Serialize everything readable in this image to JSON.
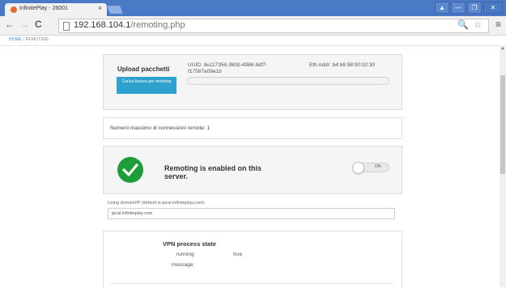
{
  "browser": {
    "tab_title": "InfinitePlay - 26001",
    "tab_close": "×",
    "url_host": "192.168.104.1",
    "url_path": "/remoting.php",
    "window_buttons": [
      "▲",
      "—",
      "❐",
      "✕"
    ]
  },
  "breadcrumb": {
    "home": "HOME",
    "separator": "/",
    "current": "REMOTING"
  },
  "upload": {
    "title": "Upload pacchetti",
    "button_label": "Carica licenza per remoting",
    "uuid_label": "UUID:",
    "uuid_value_line1": "9e117356-360b-4986-9df7-",
    "uuid_value_line2": "f17567a09e1b",
    "eth_label": "Eth Addr:",
    "eth_value": "b4:66:98:00:02:30",
    "progress_fraction": 0
  },
  "max_connections": {
    "text": "Numero massimo di connessioni remote: 1"
  },
  "remoting": {
    "status_text": "Remoting is enabled on this server.",
    "toggle_label": "ON",
    "toggle_on": true
  },
  "domain": {
    "label_prefix": "Using domain/IP (default is ",
    "label_default": "ipcal.infiniteplay.com",
    "label_suffix": ")",
    "value": "ipcal.infiniteplay.com"
  },
  "vpn": {
    "title": "VPN process state",
    "running_label": "running",
    "running_value": "true",
    "message_label": "message:"
  },
  "colors": {
    "chrome_blue": "#4a79c6",
    "accent": "#2ea2cc",
    "success": "#1e9e3a"
  }
}
